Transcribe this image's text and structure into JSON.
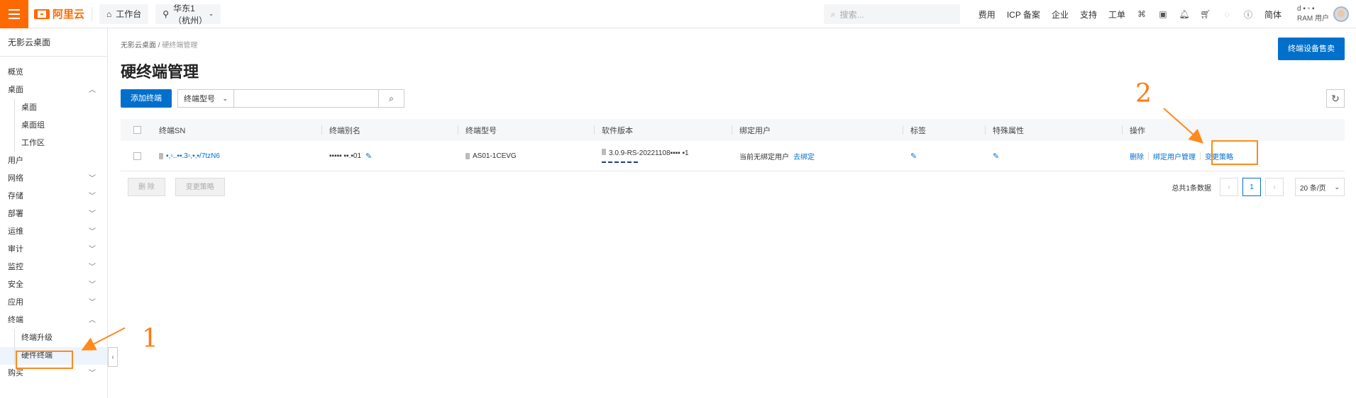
{
  "topbar": {
    "logo_text": "阿里云",
    "workbench": "工作台",
    "region": "华东1（杭州）",
    "search_placeholder": "搜索...",
    "links": [
      "费用",
      "ICP 备案",
      "企业",
      "支持",
      "工单"
    ],
    "lang": "简体",
    "user_line1": "d ▪ ▫ ▪",
    "user_line2": "RAM 用户"
  },
  "sidebar": {
    "title": "无影云桌面",
    "items": [
      {
        "label": "概览"
      },
      {
        "label": "桌面",
        "chevron": "up"
      },
      {
        "label": "桌面",
        "sub": true
      },
      {
        "label": "桌面组",
        "sub": true
      },
      {
        "label": "工作区",
        "sub": true
      },
      {
        "label": "用户"
      },
      {
        "label": "网络",
        "chevron": "down"
      },
      {
        "label": "存储",
        "chevron": "down"
      },
      {
        "label": "部署",
        "chevron": "down"
      },
      {
        "label": "运维",
        "chevron": "down"
      },
      {
        "label": "审计",
        "chevron": "down"
      },
      {
        "label": "监控",
        "chevron": "down"
      },
      {
        "label": "安全",
        "chevron": "down"
      },
      {
        "label": "应用",
        "chevron": "down"
      },
      {
        "label": "终端",
        "chevron": "up"
      },
      {
        "label": "终端升级",
        "sub": true
      },
      {
        "label": "硬件终端",
        "sub": true,
        "active": true
      },
      {
        "label": "购买",
        "chevron": "down"
      }
    ]
  },
  "main": {
    "breadcrumb": [
      "无影云桌面",
      "硬终端管理"
    ],
    "title": "硬终端管理",
    "top_button": "终端设备售卖",
    "add_button": "添加终端",
    "filter_select": "终端型号",
    "columns": [
      "终端SN",
      "终端别名",
      "终端型号",
      "软件版本",
      "绑定用户",
      "标签",
      "特殊属性",
      "操作"
    ],
    "row": {
      "sn": "▪,▫..▪▪.3▫,▪,▪/7tzN6",
      "alias": "▪▪▪▪▪ ▪▪.▪01",
      "model": "AS01-1CEVG",
      "version": "3.0.9-RS-20221108▪▪▪▪ ▪1",
      "bind_user": "当前无绑定用户",
      "bind_link": "去绑定",
      "ops": [
        "删除",
        "绑定用户管理",
        "变更策略"
      ]
    },
    "bulk_buttons": [
      "删 除",
      "变更策略"
    ],
    "total_text": "总共1条数据",
    "current_page": "1",
    "page_size": "20 条/页"
  },
  "annotations": {
    "num1": "1",
    "num2": "2",
    "color": "#ff8a1c"
  }
}
